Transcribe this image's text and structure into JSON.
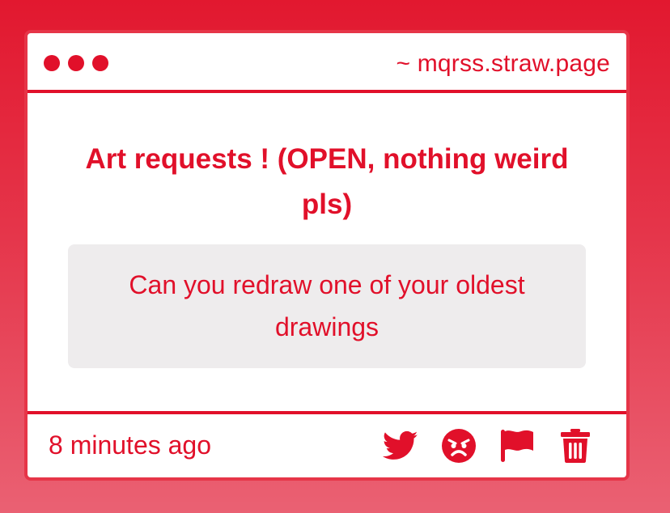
{
  "window": {
    "url": "~ mqrss.straw.page"
  },
  "post": {
    "title": "Art requests ! (OPEN, nothing weird pls)",
    "message": "Can you redraw one of your oldest drawings",
    "time": "8 minutes ago"
  },
  "actions": [
    {
      "icon": "twitter-icon"
    },
    {
      "icon": "angry-face-icon"
    },
    {
      "icon": "flag-icon"
    },
    {
      "icon": "trash-icon"
    }
  ],
  "colors": {
    "accent": "#e1102a",
    "background_top": "#e2182f",
    "background_bottom": "#ea6173",
    "message_bg": "#eeeced"
  }
}
